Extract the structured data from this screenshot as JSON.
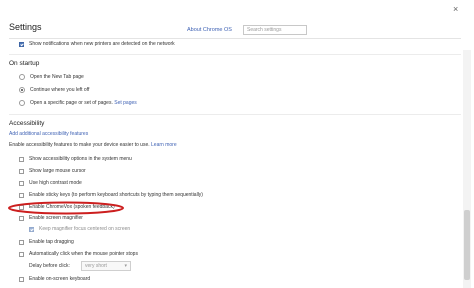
{
  "header": {
    "title": "Settings",
    "about_link": "About Chrome OS",
    "search_placeholder": "Search settings",
    "close_glyph": "×"
  },
  "top": {
    "printers_notification": {
      "label": "Show notifications when new printers are detected on the network",
      "checked": true
    }
  },
  "on_startup": {
    "heading": "On startup",
    "options": [
      {
        "label": "Open the New Tab page",
        "selected": false
      },
      {
        "label": "Continue where you left off",
        "selected": true
      },
      {
        "label": "Open a specific page or set of pages.",
        "selected": false
      }
    ],
    "set_pages_link": "Set pages"
  },
  "accessibility": {
    "heading": "Accessibility",
    "add_features_link": "Add additional accessibility features",
    "description": "Enable accessibility features to make your device easier to use.",
    "learn_more_link": "Learn more",
    "items": [
      {
        "label": "Show accessibility options in the system menu",
        "checked": false
      },
      {
        "label": "Show large mouse cursor",
        "checked": false
      },
      {
        "label": "Use high contrast mode",
        "checked": false
      },
      {
        "label": "Enable sticky keys (to perform keyboard shortcuts by typing them sequentially)",
        "checked": false
      },
      {
        "label": "Enable ChromeVox (spoken feedback)",
        "checked": false
      },
      {
        "label": "Enable screen magnifier",
        "checked": false
      },
      {
        "label": "Keep magnifier focus centered on screen",
        "checked": true,
        "disabled": true
      },
      {
        "label": "Enable tap dragging",
        "checked": false
      },
      {
        "label": "Automatically click when the mouse pointer stops",
        "checked": false
      }
    ],
    "delay_label": "Delay before click:",
    "delay_value": "very short",
    "onscreen_keyboard": {
      "label": "Enable on-screen keyboard",
      "checked": false
    }
  },
  "colors": {
    "link": "#3f62b4",
    "checkbox_checked": "#4a74b7",
    "annotation_ellipse": "#cc1f1f"
  }
}
